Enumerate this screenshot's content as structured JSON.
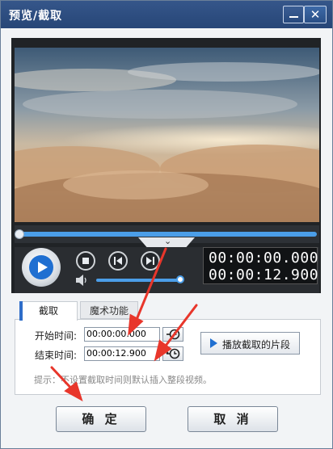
{
  "window": {
    "title": "预览/截取",
    "minimize_label": "_",
    "close_label": "✕"
  },
  "player": {
    "current_time": "00:00:00.000",
    "total_time": "00:00:12.900",
    "progress": 0,
    "volume": 0.96,
    "icons": [
      "play-icon",
      "stop-icon",
      "previous-frame-icon",
      "next-frame-icon",
      "volume-icon",
      "chevron-down-icon"
    ]
  },
  "tabs": [
    {
      "label": "截取",
      "active": true
    },
    {
      "label": "魔术功能",
      "active": false
    }
  ],
  "clip": {
    "start_label": "开始时间:",
    "start_value": "00:00:00.000",
    "end_label": "结束时间:",
    "end_value": "00:00:12.900",
    "play_clip_label": "播放截取的片段",
    "hint": "提示：不设置截取时间则默认插入整段视频。"
  },
  "buttons": {
    "ok": "确 定",
    "cancel": "取 消"
  },
  "colors": {
    "titlebar": "#2f5083",
    "accent": "#4b9ee8",
    "annotation_arrow": "#e8362b"
  }
}
